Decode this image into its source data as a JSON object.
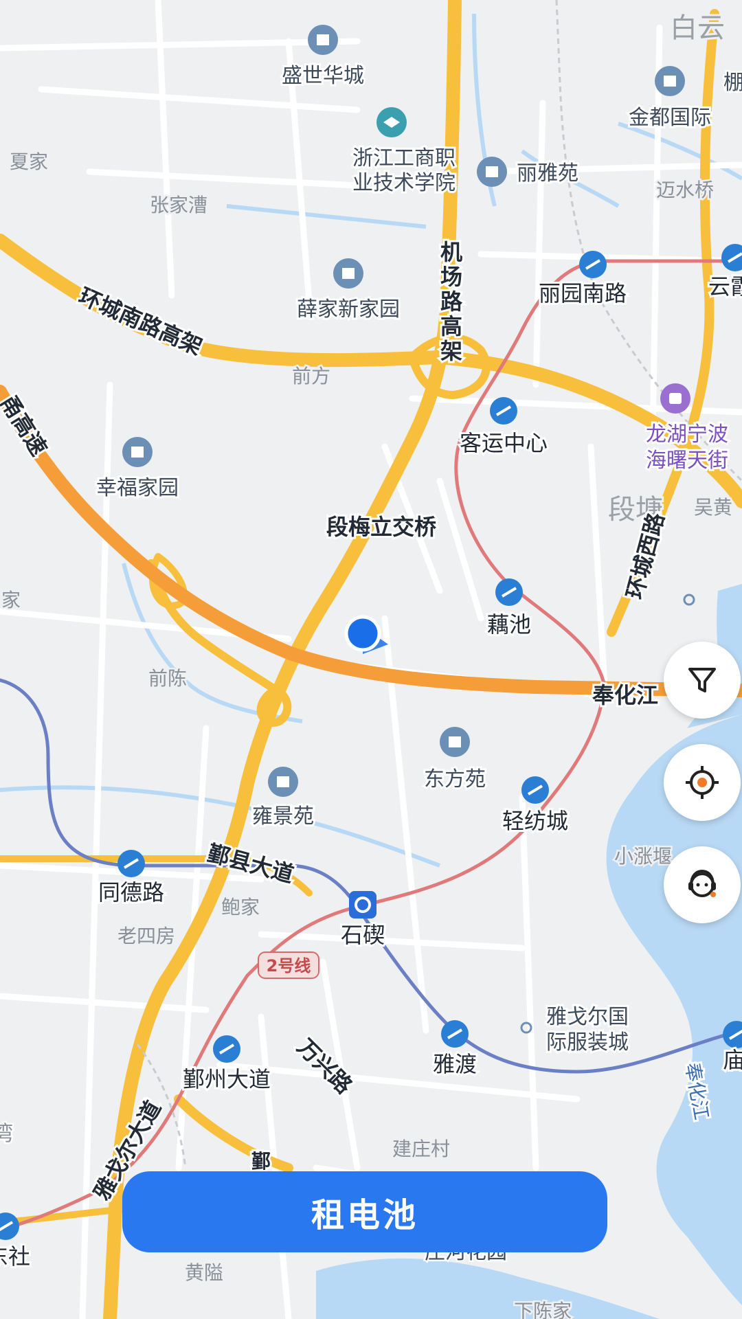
{
  "map": {
    "districts": [
      "白云",
      "段塘"
    ],
    "places": [
      "盛世华城",
      "金都国际",
      "浙江工商职业技术学院",
      "丽雅苑",
      "薛家新家园",
      "幸福家园",
      "东方苑",
      "雍景苑",
      "雅戈尔国际服装城",
      "龙湖宁波海曙天街"
    ],
    "areas": [
      "夏家",
      "张家漕",
      "迈水桥",
      "前方",
      "吴黄",
      "家",
      "前陈",
      "小涨堰",
      "鲍家",
      "老四房",
      "建庄村",
      "黄隘",
      "下陈家"
    ],
    "roads": [
      "环城南路高架",
      "机场路高架",
      "段梅立交桥",
      "环城西路",
      "奉化江",
      "鄞县大道",
      "万兴路",
      "雅戈尔大道",
      "奉化江",
      "甬高速"
    ],
    "stations": [
      "丽园南路",
      "客运中心",
      "藕池",
      "轻纺城",
      "同德路",
      "石碶",
      "鄞州大道",
      "雅渡",
      "云霞",
      "庙",
      "东社"
    ],
    "line_badge": "2号线",
    "partial_labels": [
      "棚",
      "湾",
      "庄河花园",
      "鄞"
    ]
  },
  "controls": {
    "filter_icon": "filter-icon",
    "locate_icon": "locate-icon",
    "service_icon": "customer-service-icon"
  },
  "action": {
    "rent_label": "租电池"
  },
  "colors": {
    "highway": "#f7bf3b",
    "expressway": "#f59d38",
    "metro_red": "#e07a7a",
    "metro_blue": "#6a7fc4",
    "water": "#b8d9f5",
    "accent": "#2a78f0",
    "location_dot": "#1a6fe8"
  }
}
